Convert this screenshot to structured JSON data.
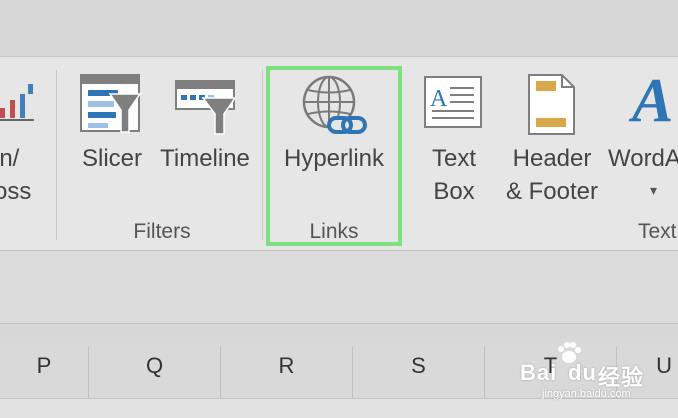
{
  "ribbon": {
    "partial_left_label": [
      "in/",
      "oss"
    ],
    "buttons": {
      "slicer": "Slicer",
      "timeline": "Timeline",
      "hyperlink": "Hyperlink",
      "text_box": [
        "Text",
        "Box"
      ],
      "header_footer": [
        "Header",
        "& Footer"
      ],
      "wordart": "WordA",
      "wordart_caret": "▾"
    },
    "groups": {
      "filters": "Filters",
      "links": "Links",
      "text": "Text"
    },
    "highlight_color": "#7ee07e"
  },
  "sheet": {
    "columns": [
      "P",
      "Q",
      "R",
      "S",
      "T",
      "U"
    ]
  },
  "watermark": {
    "brand": "Bai",
    "brand2": "du",
    "cn": "经验",
    "url": "jingyan.baidu.com"
  }
}
